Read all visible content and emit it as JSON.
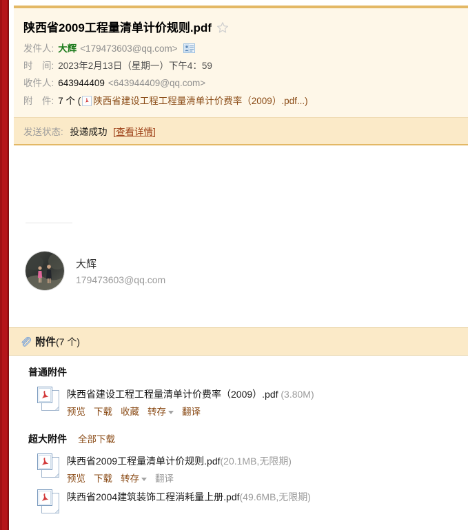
{
  "mail": {
    "subject": "陕西省2009工程量清单计价规则.pdf",
    "star_icon": "star-icon",
    "fields": {
      "from_label": "发件人:",
      "from_name": "大辉",
      "from_address": "<179473603@qq.com>",
      "contact_card_icon": "contact-card-icon",
      "time_label": "时　间:",
      "time_value": "2023年2月13日（星期一）下午4：59",
      "to_label": "收件人:",
      "to_name": "643944409",
      "to_address": "<643944409@qq.com>",
      "attach_label": "附　件:",
      "attach_count_text": "7 个 (",
      "attach_pdf_icon": "pdf-icon",
      "attach_first_name": "陕西省建设工程工程量清单计价费率（2009）.pdf...)",
      "status_label": "发送状态:",
      "status_value": "投递成功",
      "status_detail": "[查看详情]"
    }
  },
  "signature": {
    "avatar_icon": "avatar",
    "name": "大辉",
    "email": "179473603@qq.com"
  },
  "attachments_panel": {
    "clip_icon": "paperclip-icon",
    "title": "附件",
    "count_text": "(7 个)",
    "sections": [
      {
        "title": "普通附件",
        "action": "",
        "items": [
          {
            "icon": "pdf-file-icon",
            "name": "陕西省建设工程工程量清单计价费率（2009）.pdf",
            "size": "(3.80M)",
            "actions": [
              {
                "label": "预览",
                "enabled": true,
                "caret": false
              },
              {
                "label": "下载",
                "enabled": true,
                "caret": false
              },
              {
                "label": "收藏",
                "enabled": true,
                "caret": false
              },
              {
                "label": "转存",
                "enabled": true,
                "caret": true
              },
              {
                "label": "翻译",
                "enabled": true,
                "caret": false
              }
            ]
          }
        ]
      },
      {
        "title": "超大附件",
        "action": "全部下载",
        "items": [
          {
            "icon": "pdf-file-icon",
            "name": "陕西省2009工程量清单计价规则.pdf",
            "size": "(20.1MB,无限期)",
            "actions": [
              {
                "label": "预览",
                "enabled": true,
                "caret": false
              },
              {
                "label": "下载",
                "enabled": true,
                "caret": false
              },
              {
                "label": "转存",
                "enabled": true,
                "caret": true
              },
              {
                "label": "翻译",
                "enabled": false,
                "caret": false
              }
            ]
          },
          {
            "icon": "pdf-file-icon",
            "name": "陕西省2004建筑装饰工程消耗量上册.pdf",
            "size": "(49.6MB,无限期)",
            "actions": []
          }
        ]
      }
    ]
  },
  "colors": {
    "rail_red": "#a11014",
    "header_bg": "#fef7e8",
    "header_border": "#e3b865",
    "status_bg": "#fbeac8",
    "link_brown": "#8a4b16",
    "sender_green": "#1b7a1b",
    "muted_gray": "#9b9b9b"
  }
}
